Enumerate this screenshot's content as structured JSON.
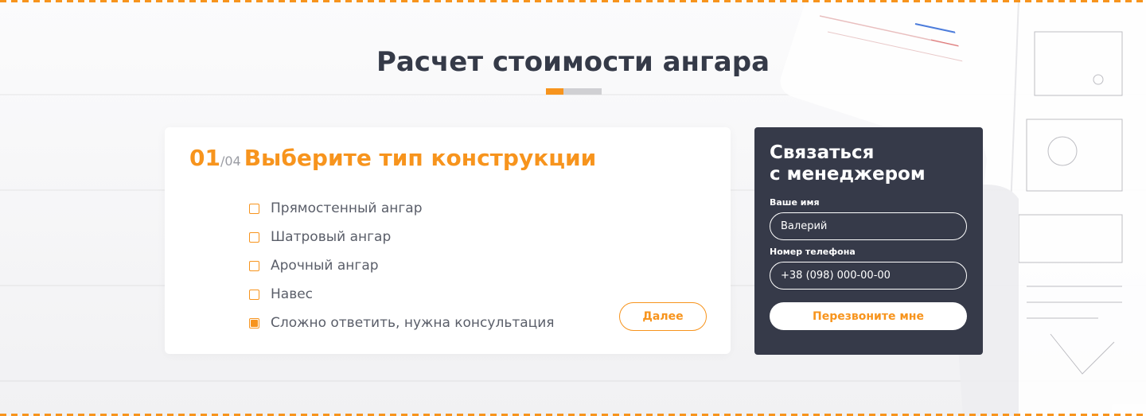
{
  "page": {
    "title": "Расчет стоимости ангара"
  },
  "quiz": {
    "step_current": "01",
    "step_total": "/04",
    "step_title": "Выберите тип конструкции",
    "options": [
      {
        "label": "Прямостенный ангар",
        "checked": false
      },
      {
        "label": "Шатровый ангар",
        "checked": false
      },
      {
        "label": "Арочный ангар",
        "checked": false
      },
      {
        "label": "Навес",
        "checked": false
      },
      {
        "label": "Сложно ответить, нужна консультация",
        "checked": true
      }
    ],
    "next_label": "Далее"
  },
  "contact": {
    "title_line1": "Связаться",
    "title_line2": "с менеджером",
    "name_label": "Ваше имя",
    "name_value": "Валерий",
    "phone_label": "Номер телефона",
    "phone_value": "+38 (098) 000-00-00",
    "submit_label": "Перезвоните мне"
  },
  "colors": {
    "accent": "#f7941d",
    "dark_panel": "#363a49",
    "title_text": "#353a48"
  }
}
